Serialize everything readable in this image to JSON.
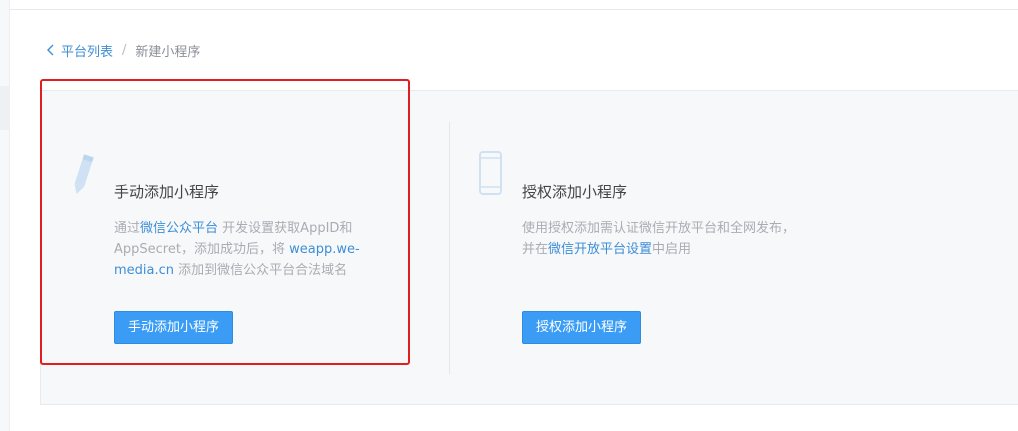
{
  "breadcrumb": {
    "parent": "平台列表",
    "separator": "/",
    "current": "新建小程序"
  },
  "manual_option": {
    "icon": "pencil-icon",
    "title": "手动添加小程序",
    "desc_part1": "通过",
    "desc_link1": "微信公众平台",
    "desc_part2": "开发设置获取AppID和AppSecret，添加成功后，将",
    "desc_link2": "weapp.we-media.cn",
    "desc_part3": "添加到微信公众平台合法域名",
    "button_label": "手动添加小程序"
  },
  "authorize_option": {
    "icon": "mobile-phone-icon",
    "title": "授权添加小程序",
    "desc_line1": "使用授权添加需认证微信开放平台和全网发布，",
    "desc_part2": "并在",
    "desc_link": "微信开放平台设置",
    "desc_part3": "中启用",
    "button_label": "授权添加小程序"
  },
  "colors": {
    "accent": "#3a9cf5",
    "link": "#3e8ed6",
    "highlight_border": "#e02020",
    "panel_bg": "#f7f8fa"
  }
}
